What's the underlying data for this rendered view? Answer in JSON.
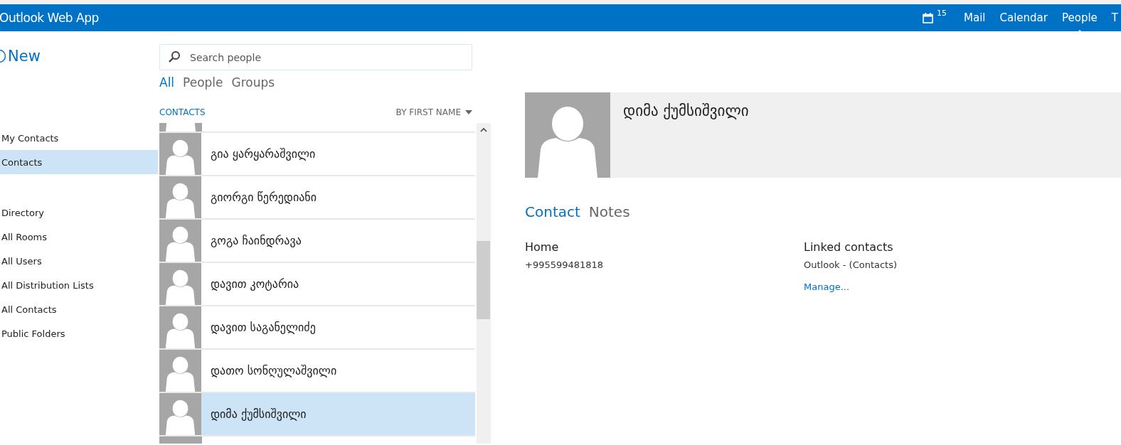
{
  "app_title": "Outlook Web App",
  "topbar": {
    "calendar_badge": "15",
    "nav": [
      {
        "label": "Mail",
        "selected": false
      },
      {
        "label": "Calendar",
        "selected": false
      },
      {
        "label": "People",
        "selected": true
      },
      {
        "label": "T",
        "selected": false
      }
    ]
  },
  "new_button": "New",
  "sidebar": {
    "groups": [
      {
        "items": [
          {
            "label": "My Contacts",
            "selected": false
          },
          {
            "label": "Contacts",
            "selected": true
          }
        ]
      },
      {
        "items": [
          {
            "label": "Directory",
            "selected": false
          },
          {
            "label": "All Rooms",
            "selected": false
          },
          {
            "label": "All Users",
            "selected": false
          },
          {
            "label": "All Distribution Lists",
            "selected": false
          },
          {
            "label": "All Contacts",
            "selected": false
          },
          {
            "label": "Public Folders",
            "selected": false
          }
        ]
      }
    ]
  },
  "search": {
    "placeholder": "Search people"
  },
  "filters": [
    {
      "label": "All",
      "selected": true
    },
    {
      "label": "People",
      "selected": false
    },
    {
      "label": "Groups",
      "selected": false
    }
  ],
  "list_header": {
    "title": "CONTACTS",
    "sort": "BY FIRST NAME"
  },
  "contacts": [
    {
      "name": "გია ყარყარაშვილი",
      "selected": false
    },
    {
      "name": "გიორგი წერედიანი",
      "selected": false
    },
    {
      "name": "გოგა ჩაინდრავა",
      "selected": false
    },
    {
      "name": "დავით კოტარია",
      "selected": false
    },
    {
      "name": "დავით საგანელიძე",
      "selected": false
    },
    {
      "name": "დათო სონღულაშვილი",
      "selected": false
    },
    {
      "name": "დიმა ქუმსიშვილი",
      "selected": true
    }
  ],
  "detail": {
    "name": "დიმა ქუმსიშვილი",
    "tabs": [
      {
        "label": "Contact",
        "selected": true
      },
      {
        "label": "Notes",
        "selected": false
      }
    ],
    "home": {
      "label": "Home",
      "phone": "+995599481818"
    },
    "linked": {
      "label": "Linked contacts",
      "source": "Outlook - (Contacts)",
      "manage": "Manage..."
    }
  }
}
